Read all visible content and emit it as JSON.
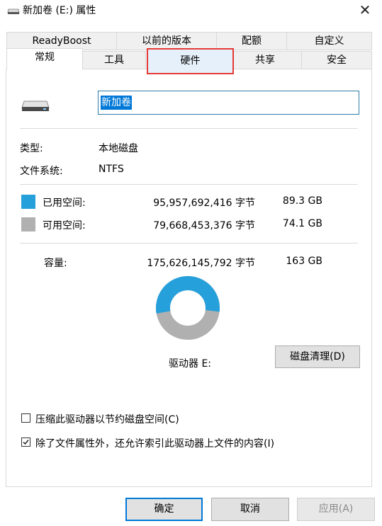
{
  "window": {
    "title": "新加卷 (E:) 属性",
    "close_label": "✕"
  },
  "tabs": {
    "row_back": [
      "ReadyBoost",
      "以前的版本",
      "配额",
      "自定义"
    ],
    "row_front": [
      "常规",
      "工具",
      "硬件",
      "共享",
      "安全"
    ],
    "active": "常规",
    "highlighted": "硬件"
  },
  "general": {
    "volume_name": "新加卷",
    "type_label": "类型:",
    "type_value": "本地磁盘",
    "fs_label": "文件系统:",
    "fs_value": "NTFS",
    "used": {
      "label": "已用空间:",
      "bytes": "95,957,692,416 字节",
      "size": "89.3 GB",
      "color": "#26a0da"
    },
    "free": {
      "label": "可用空间:",
      "bytes": "79,668,453,376 字节",
      "size": "74.1 GB",
      "color": "#b0b0b0"
    },
    "capacity": {
      "label": "容量:",
      "bytes": "175,626,145,792 字节",
      "size": "163 GB"
    },
    "used_fraction": 0.546,
    "drive_label": "驱动器 E:",
    "cleanup_button": "磁盘清理(D)",
    "compress_label": "压缩此驱动器以节约磁盘空间(C)",
    "compress_checked": false,
    "index_label": "除了文件属性外，还允许索引此驱动器上文件的内容(I)",
    "index_checked": true
  },
  "buttons": {
    "ok": "确定",
    "cancel": "取消",
    "apply": "应用(A)"
  }
}
